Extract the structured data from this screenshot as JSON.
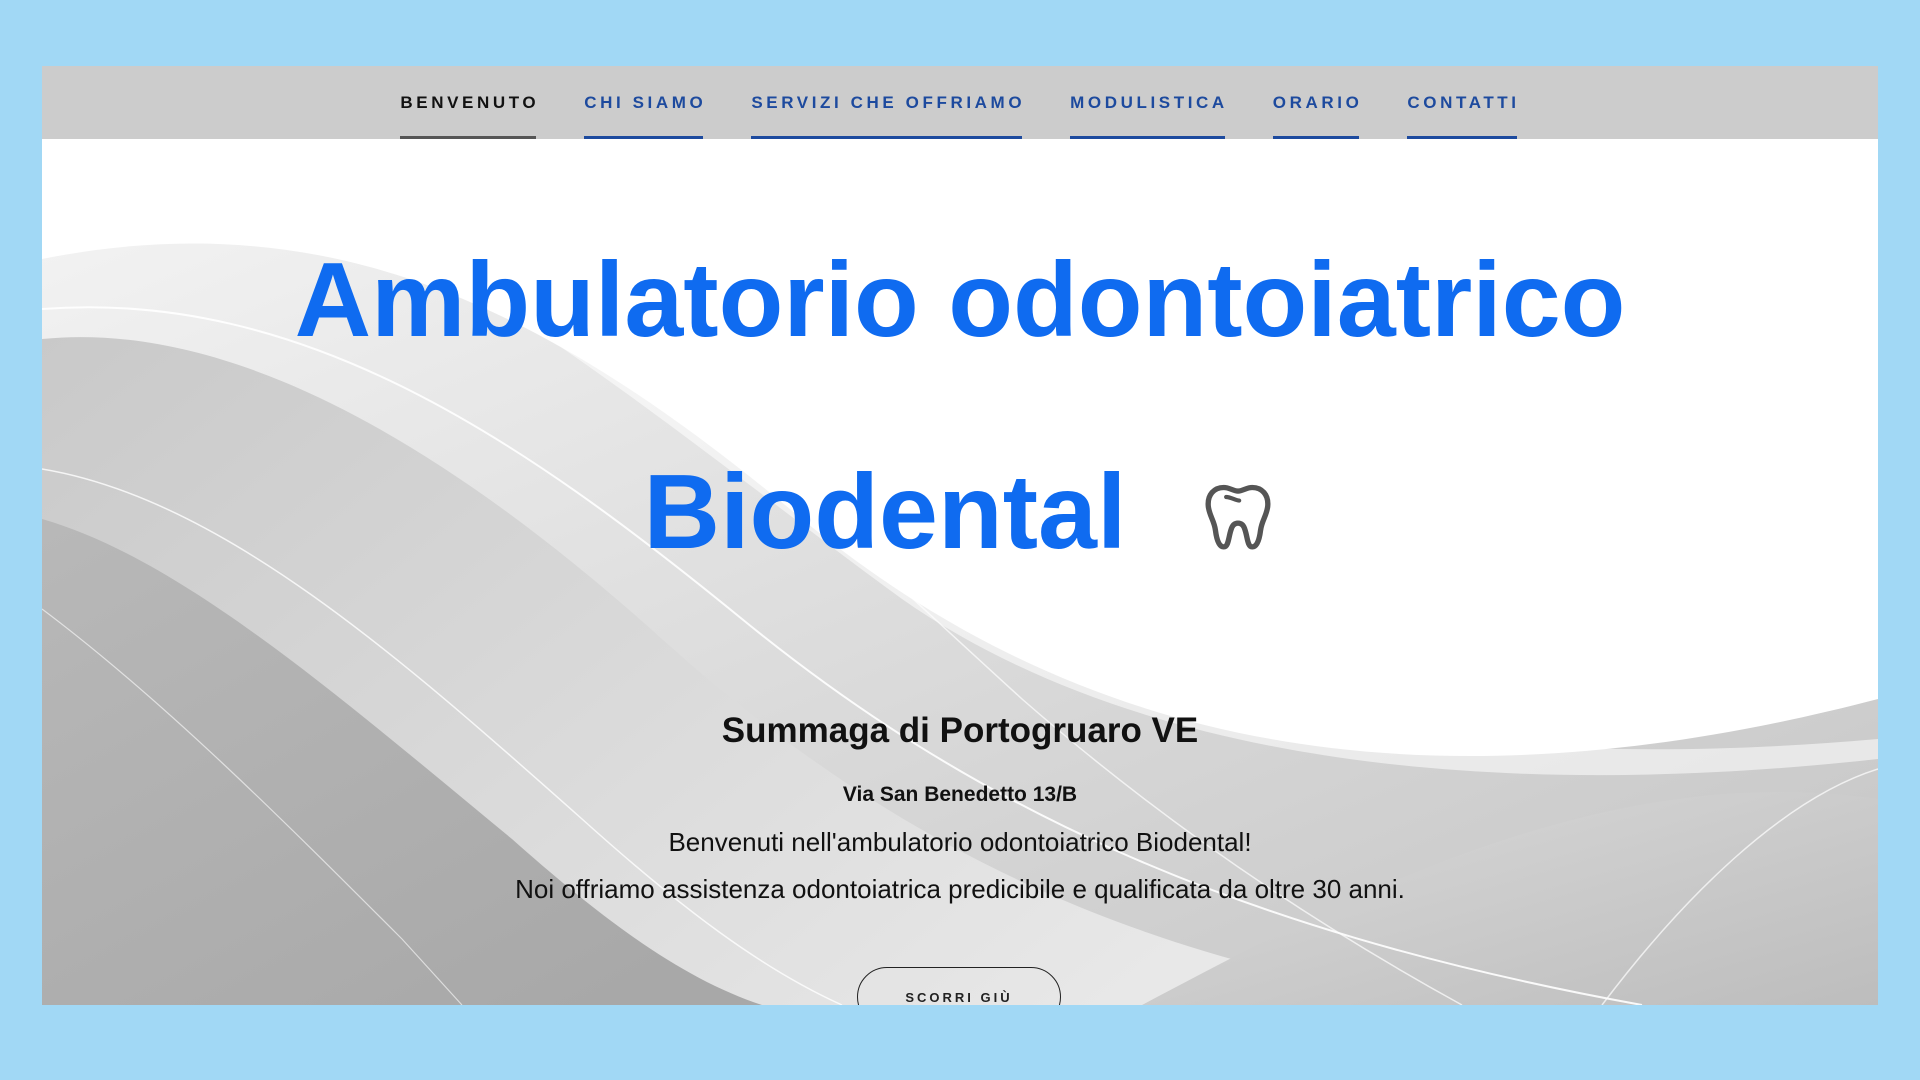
{
  "nav": {
    "items": [
      {
        "label": "BENVENUTO",
        "active": true
      },
      {
        "label": "CHI SIAMO",
        "active": false
      },
      {
        "label": "SERVIZI CHE OFFRIAMO",
        "active": false
      },
      {
        "label": "MODULISTICA",
        "active": false
      },
      {
        "label": "ORARIO",
        "active": false
      },
      {
        "label": "CONTATTI",
        "active": false
      }
    ]
  },
  "hero": {
    "title_line1": "Ambulatorio odontoiatrico",
    "title_line2": "Biodental",
    "logo_icon": "tooth-icon",
    "subtitle": "Summaga di Portogruaro VE",
    "address": "Via San Benedetto 13/B",
    "welcome": "Benvenuti nell'ambulatorio odontoiatrico Biodental!",
    "description": "Noi offriamo assistenza odontoiatrica predicibile e qualificata da oltre 30 anni.",
    "scroll_button": "SCORRI GIÙ"
  },
  "colors": {
    "page_background": "#a1d8f5",
    "nav_background": "#cccccc",
    "nav_link": "#1d4a9e",
    "title": "#0f6bf0",
    "text": "#111111"
  }
}
